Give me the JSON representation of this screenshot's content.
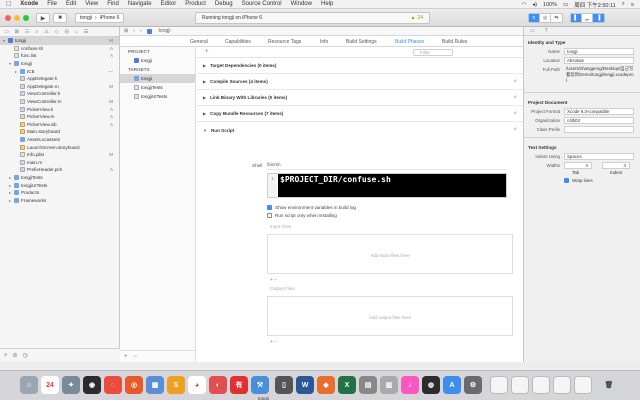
{
  "menubar": {
    "app": "Xcode",
    "items": [
      "File",
      "Edit",
      "View",
      "Find",
      "Navigate",
      "Editor",
      "Product",
      "Debug",
      "Source Control",
      "Window",
      "Help"
    ],
    "battery": "100%",
    "clock": "周四 下午2:50:11"
  },
  "toolbar": {
    "scheme": "tongji",
    "device": "iPhone 6",
    "status": "Running tongji on iPhone 6",
    "warnings": "24"
  },
  "navigator": {
    "rows": [
      {
        "label": "tongji",
        "icon": "proj",
        "indent": 0,
        "disc": "▾",
        "badge": "M",
        "sel": true
      },
      {
        "label": "confuse.sh",
        "icon": "plist",
        "indent": 1,
        "disc": "",
        "badge": "A"
      },
      {
        "label": "func.list",
        "icon": "plist",
        "indent": 1,
        "disc": "",
        "badge": "A"
      },
      {
        "label": "tongji",
        "icon": "folder",
        "indent": 1,
        "disc": "▾",
        "badge": ""
      },
      {
        "label": "ICE",
        "icon": "folder",
        "indent": 2,
        "disc": "▸",
        "badge": "—"
      },
      {
        "label": "AppDelegate.h",
        "icon": "h",
        "indent": 2,
        "disc": "",
        "badge": ""
      },
      {
        "label": "AppDelegate.m",
        "icon": "m",
        "indent": 2,
        "disc": "",
        "badge": "M"
      },
      {
        "label": "ViewController.h",
        "icon": "h",
        "indent": 2,
        "disc": "",
        "badge": ""
      },
      {
        "label": "ViewController.m",
        "icon": "m",
        "indent": 2,
        "disc": "",
        "badge": "M"
      },
      {
        "label": "PickerView.h",
        "icon": "h",
        "indent": 2,
        "disc": "",
        "badge": "A"
      },
      {
        "label": "PickerView.m",
        "icon": "m",
        "indent": 2,
        "disc": "",
        "badge": "A"
      },
      {
        "label": "PickerView.xib",
        "icon": "xib",
        "indent": 2,
        "disc": "",
        "badge": "A"
      },
      {
        "label": "Main.storyboard",
        "icon": "xib",
        "indent": 2,
        "disc": "",
        "badge": ""
      },
      {
        "label": "Assets.xcassets",
        "icon": "folder",
        "indent": 2,
        "disc": "",
        "badge": ""
      },
      {
        "label": "LaunchScreen.storyboard",
        "icon": "xib",
        "indent": 2,
        "disc": "",
        "badge": ""
      },
      {
        "label": "Info.plist",
        "icon": "plist",
        "indent": 2,
        "disc": "",
        "badge": "M"
      },
      {
        "label": "main.m",
        "icon": "m",
        "indent": 2,
        "disc": "",
        "badge": ""
      },
      {
        "label": "PrefixHeader.pch",
        "icon": "h",
        "indent": 2,
        "disc": "",
        "badge": "A"
      },
      {
        "label": "tongjiTests",
        "icon": "folder",
        "indent": 1,
        "disc": "▸",
        "badge": ""
      },
      {
        "label": "tongjiUITests",
        "icon": "folder",
        "indent": 1,
        "disc": "▸",
        "badge": ""
      },
      {
        "label": "Products",
        "icon": "folder",
        "indent": 1,
        "disc": "▸",
        "badge": ""
      },
      {
        "label": "Frameworks",
        "icon": "folder",
        "indent": 1,
        "disc": "▸",
        "badge": ""
      }
    ]
  },
  "editor": {
    "breadcrumb": "tongji",
    "tabs": [
      "General",
      "Capabilities",
      "Resource Tags",
      "Info",
      "Build Settings",
      "Build Phases",
      "Build Rules"
    ],
    "project_header": "PROJECT",
    "project_item": "tongji",
    "targets_header": "TARGETS",
    "targets": [
      "tongji",
      "tongjiTests",
      "tongjiUITests"
    ],
    "filter_placeholder": "Filter",
    "phases": [
      "Target Dependencies (0 items)",
      "Compile Sources (4 items)",
      "Link Binary With Libraries (0 items)",
      "Copy Bundle Resources (7 items)"
    ],
    "run_script": {
      "title": "Run Script",
      "shell_label": "Shell",
      "shell_value": "/bin/sh",
      "line_number": "1",
      "code": "$PROJECT_DIR/confuse.sh",
      "opt1": "Show environment variables in build log",
      "opt2": "Run script only when installing",
      "input_head": "Input Files",
      "input_add": "Add input files here",
      "output_head": "Output Files",
      "output_add": "Add output files here"
    }
  },
  "inspector": {
    "identity_title": "Identity and Type",
    "name_label": "Name",
    "name_value": "tongji",
    "location_label": "Location",
    "location_value": "Absolute",
    "fullpath_label": "Full Path",
    "fullpath_value": "/Users/zhangpeng/Desktop/自己写着玩的Demo/tongji/tongji.xcodeproj",
    "projdoc_title": "Project Document",
    "format_label": "Project Format",
    "format_value": "Xcode 9.3-compatible",
    "org_label": "Organization",
    "org_value": "c4lb03",
    "classprefix_label": "Class Prefix",
    "textsettings_title": "Text Settings",
    "indent_label": "Indent Using",
    "indent_value": "Spaces",
    "widths_label": "Widths",
    "tab_value": "4",
    "indent_num": "4",
    "tab_caption": "Tab",
    "indent_caption": "Indent",
    "wrap_label": "Wrap lines"
  },
  "dock": {
    "badge_calendar": "24",
    "app_tab": "tongji"
  }
}
